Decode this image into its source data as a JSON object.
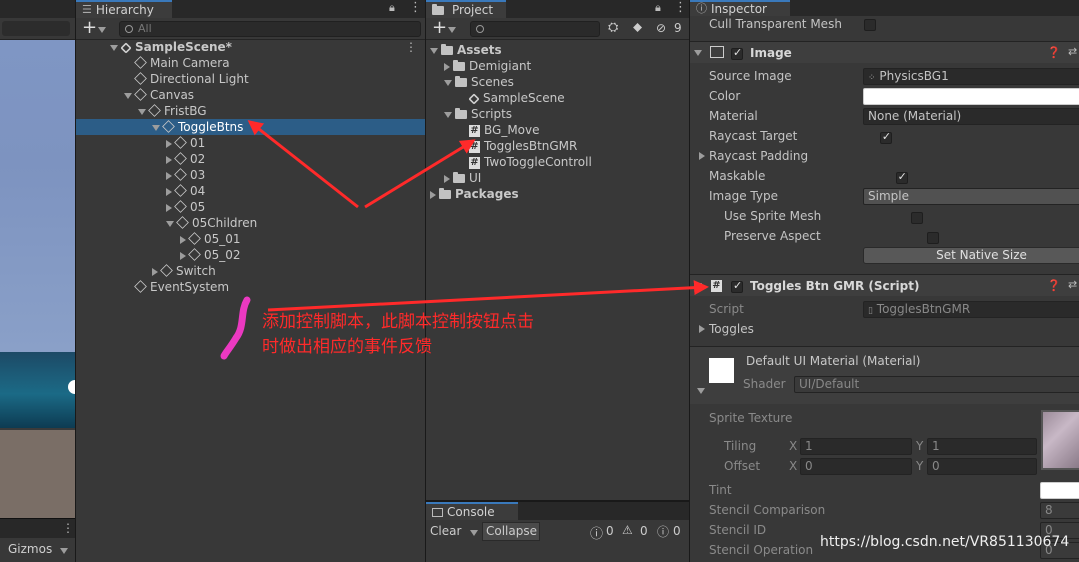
{
  "scene": {
    "gizmos_label": "Gizmos"
  },
  "hierarchy": {
    "tab_label": "Hierarchy",
    "search_placeholder": "All",
    "add_label": "+",
    "rows": [
      {
        "label": "SampleScene*",
        "depth": 0,
        "arrow": "down",
        "icon": "unity",
        "bold": true,
        "selected": false
      },
      {
        "label": "Main Camera",
        "depth": 1,
        "arrow": "none",
        "icon": "cube",
        "bold": false,
        "selected": false
      },
      {
        "label": "Directional Light",
        "depth": 1,
        "arrow": "none",
        "icon": "cube",
        "bold": false,
        "selected": false
      },
      {
        "label": "Canvas",
        "depth": 1,
        "arrow": "down",
        "icon": "cube",
        "bold": false,
        "selected": false
      },
      {
        "label": "FristBG",
        "depth": 2,
        "arrow": "down",
        "icon": "cube",
        "bold": false,
        "selected": false
      },
      {
        "label": "ToggleBtns",
        "depth": 3,
        "arrow": "down",
        "icon": "cube",
        "bold": false,
        "selected": true
      },
      {
        "label": "01",
        "depth": 4,
        "arrow": "right",
        "icon": "cube",
        "bold": false,
        "selected": false
      },
      {
        "label": "02",
        "depth": 4,
        "arrow": "right",
        "icon": "cube",
        "bold": false,
        "selected": false
      },
      {
        "label": "03",
        "depth": 4,
        "arrow": "right",
        "icon": "cube",
        "bold": false,
        "selected": false
      },
      {
        "label": "04",
        "depth": 4,
        "arrow": "right",
        "icon": "cube",
        "bold": false,
        "selected": false
      },
      {
        "label": "05",
        "depth": 4,
        "arrow": "right",
        "icon": "cube",
        "bold": false,
        "selected": false
      },
      {
        "label": "05Children",
        "depth": 4,
        "arrow": "down",
        "icon": "cube",
        "bold": false,
        "selected": false
      },
      {
        "label": "05_01",
        "depth": 5,
        "arrow": "right",
        "icon": "cube",
        "bold": false,
        "selected": false
      },
      {
        "label": "05_02",
        "depth": 5,
        "arrow": "right",
        "icon": "cube",
        "bold": false,
        "selected": false
      },
      {
        "label": "Switch",
        "depth": 3,
        "arrow": "right",
        "icon": "cube",
        "bold": false,
        "selected": false
      },
      {
        "label": "EventSystem",
        "depth": 1,
        "arrow": "none",
        "icon": "cube",
        "bold": false,
        "selected": false
      }
    ]
  },
  "project": {
    "tab_label": "Project",
    "add_label": "+",
    "hidden_count": "9",
    "rows": [
      {
        "label": "Assets",
        "depth": 0,
        "arrow": "down",
        "icon": "folder",
        "bold": true
      },
      {
        "label": "Demigiant",
        "depth": 1,
        "arrow": "right",
        "icon": "folder",
        "bold": false
      },
      {
        "label": "Scenes",
        "depth": 1,
        "arrow": "down",
        "icon": "folder",
        "bold": false
      },
      {
        "label": "SampleScene",
        "depth": 2,
        "arrow": "none",
        "icon": "unity",
        "bold": false
      },
      {
        "label": "Scripts",
        "depth": 1,
        "arrow": "down",
        "icon": "folder",
        "bold": false
      },
      {
        "label": "BG_Move",
        "depth": 2,
        "arrow": "none",
        "icon": "script",
        "bold": false
      },
      {
        "label": "TogglesBtnGMR",
        "depth": 2,
        "arrow": "none",
        "icon": "script",
        "bold": false
      },
      {
        "label": "TwoToggleControll",
        "depth": 2,
        "arrow": "none",
        "icon": "script",
        "bold": false
      },
      {
        "label": "UI",
        "depth": 1,
        "arrow": "right",
        "icon": "folder",
        "bold": false
      },
      {
        "label": "Packages",
        "depth": 0,
        "arrow": "right",
        "icon": "folder",
        "bold": true
      }
    ]
  },
  "console": {
    "tab_label": "Console",
    "clear_label": "Clear",
    "collapse_label": "Collapse",
    "info_count": "0",
    "warn_count": "0",
    "error_count": "0"
  },
  "inspector": {
    "tab_label": "Inspector",
    "cull_label": "Cull Transparent Mesh",
    "image": {
      "title": "Image",
      "source_image_label": "Source Image",
      "source_image_value": "PhysicsBG1",
      "color_label": "Color",
      "material_label": "Material",
      "material_value": "None (Material)",
      "raycast_target_label": "Raycast Target",
      "raycast_padding_label": "Raycast Padding",
      "maskable_label": "Maskable",
      "image_type_label": "Image Type",
      "image_type_value": "Simple",
      "use_sprite_mesh_label": "Use Sprite Mesh",
      "preserve_aspect_label": "Preserve Aspect",
      "set_native_size_label": "Set Native Size"
    },
    "script_component": {
      "title": "Toggles Btn GMR (Script)",
      "script_label": "Script",
      "script_value": "TogglesBtnGMR",
      "toggles_label": "Toggles"
    },
    "material": {
      "title": "Default UI Material (Material)",
      "shader_label": "Shader",
      "shader_value": "UI/Default",
      "sprite_texture_label": "Sprite Texture",
      "tiling_label": "Tiling",
      "offset_label": "Offset",
      "x_label": "X",
      "y_label": "Y",
      "tiling_x": "1",
      "tiling_y": "1",
      "offset_x": "0",
      "offset_y": "0",
      "tint_label": "Tint",
      "stencil_comparison_label": "Stencil Comparison",
      "stencil_comparison_value": "8",
      "stencil_id_label": "Stencil ID",
      "stencil_id_value": "0",
      "stencil_operation_label": "Stencil Operation",
      "stencil_operation_value": "0"
    }
  },
  "annotation": {
    "line1": "添加控制脚本，此脚本控制按钮点击",
    "line2": "时做出相应的事件反馈",
    "color": "#ff2a2a"
  },
  "watermark": "https://blog.csdn.net/VR851130674"
}
